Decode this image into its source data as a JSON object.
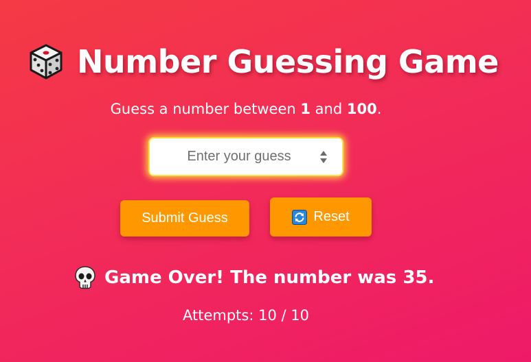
{
  "title": "Number Guessing Game",
  "title_icon": "dice-icon",
  "instruction": {
    "prefix": "Guess a number between ",
    "min": "1",
    "middle": " and ",
    "max": "100",
    "suffix": "."
  },
  "guess_input": {
    "placeholder": "Enter your guess",
    "value": ""
  },
  "buttons": {
    "submit_label": "Submit Guess",
    "reset_label": "Reset",
    "reset_icon": "refresh-icon"
  },
  "result": {
    "icon": "skull-icon",
    "text": "Game Over! The number was 35."
  },
  "attempts": {
    "label": "Attempts: ",
    "used": "10",
    "separator": " / ",
    "max": "10"
  },
  "colors": {
    "background_start": "#f53a44",
    "background_end": "#ee1a68",
    "button": "#ff9800",
    "input_glow": "#ffe14a",
    "text": "#ffffff"
  }
}
